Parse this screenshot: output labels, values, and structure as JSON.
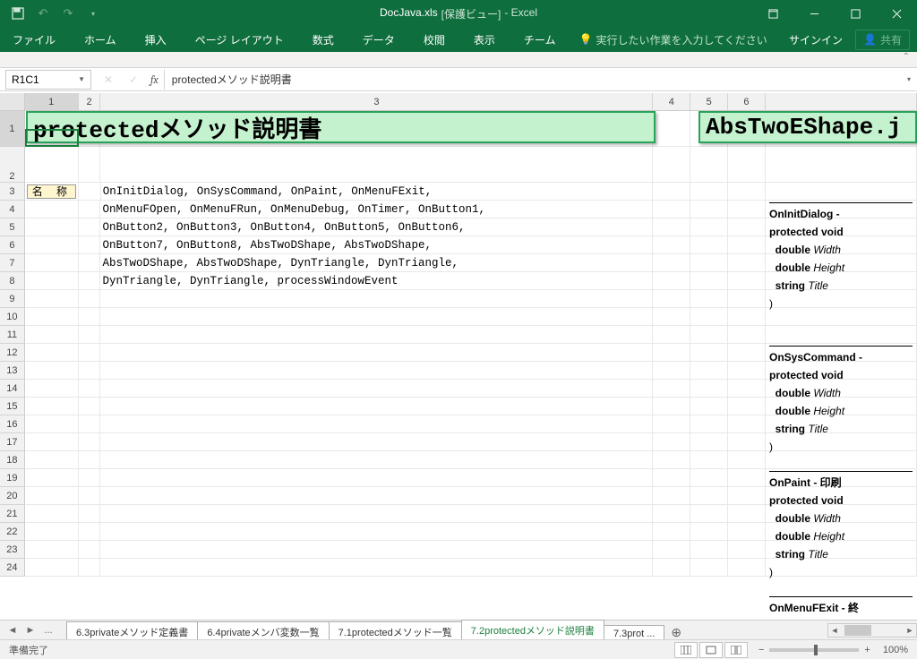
{
  "title": {
    "doc": "DocJava.xls",
    "protected": "[保護ビュー]",
    "app": "- Excel"
  },
  "ribbon": {
    "tabs": [
      "ファイル",
      "ホーム",
      "挿入",
      "ページ レイアウト",
      "数式",
      "データ",
      "校閲",
      "表示",
      "チーム"
    ],
    "tellme": "実行したい作業を入力してください",
    "signin": "サインイン",
    "share": "共有"
  },
  "fx": {
    "name": "R1C1",
    "formula": "protectedメソッド説明書"
  },
  "columns": [
    "1",
    "2",
    "3",
    "4",
    "5",
    "6"
  ],
  "rows": [
    "1",
    "2",
    "3",
    "4",
    "5",
    "6",
    "7",
    "8",
    "9",
    "10",
    "11",
    "12",
    "13",
    "14",
    "15",
    "16",
    "17",
    "18",
    "19",
    "20",
    "21",
    "22",
    "23",
    "24"
  ],
  "bigtitle1": "protectedメソッド説明書",
  "bigtitle2": "AbsTwoEShape.j",
  "label_name": "名 称",
  "list": [
    "OnInitDialog, OnSysCommand, OnPaint, OnMenuFExit,",
    "OnMenuFOpen, OnMenuFRun, OnMenuDebug, OnTimer, OnButton1,",
    "OnButton2, OnButton3, OnButton4, OnButton5, OnButton6,",
    "OnButton7, OnButton8, AbsTwoDShape, AbsTwoDShape,",
    "AbsTwoDShape, AbsTwoDShape, DynTriangle, DynTriangle,",
    "DynTriangle, DynTriangle, processWindowEvent"
  ],
  "code_blocks": [
    {
      "head": "OnInitDialog - ",
      "sig": "protected void ",
      "params": [
        "double Width",
        "double Height",
        "string Title"
      ]
    },
    {
      "head": "OnSysCommand - ",
      "sig": "protected void ",
      "params": [
        "double Width",
        "double Height",
        "string Title"
      ]
    },
    {
      "head": "OnPaint  - 印刷",
      "sig": "protected void ",
      "params": [
        "double Width",
        "double Height",
        "string Title"
      ]
    },
    {
      "head": "OnMenuFExit - 終",
      "sig": "",
      "params": []
    }
  ],
  "sheets": {
    "nav_more": "...",
    "tabs": [
      "6.3privateメソッド定義書",
      "6.4privateメンバ変数一覧",
      "7.1protectedメソッド一覧",
      "7.2protectedメソッド説明書",
      "7.3prot ..."
    ],
    "active": 3
  },
  "status": {
    "ready": "準備完了",
    "zoom": "100%"
  }
}
